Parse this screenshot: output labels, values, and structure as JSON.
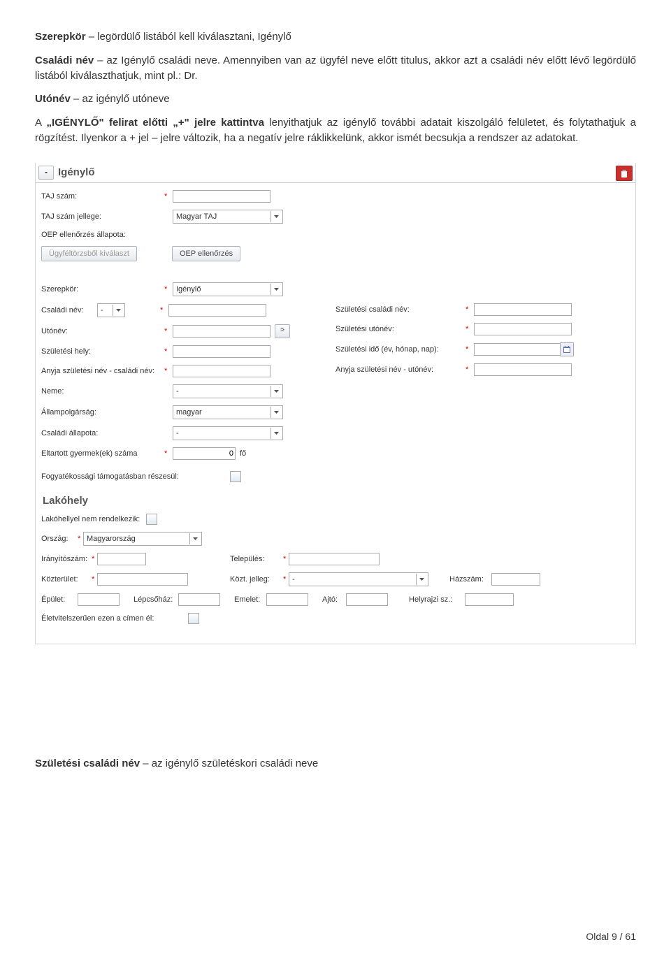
{
  "doc": {
    "p1_a": "Szerepkör",
    "p1_b": " – legördülő listából kell kiválasztani, Igénylő",
    "p2_a": "Családi név",
    "p2_b": " – az Igénylő családi neve. Amennyiben van az ügyfél neve előtt titulus, akkor azt a családi név előtt lévő legördülő listából kiválaszthatjuk, mint pl.: Dr.",
    "p3_a": "Utónév",
    "p3_b": " – az igénylő utóneve",
    "p4_pre": "A ",
    "p4_q": "„IGÉNYLŐ\" felirat előtti „+\" jelre kattintva",
    "p4_post": " lenyithatjuk az igénylő további adatait kiszolgáló felületet, és folytathatjuk a rögzítést. Ilyenkor a + jel – jelre változik, ha a negatív jelre ráklikkelünk, akkor ismét becsukja a rendszer az adatokat.",
    "footer_a": "Születési családi név",
    "footer_b": " – az igénylő születéskori családi neve",
    "page": "Oldal 9 / 61"
  },
  "form": {
    "toggle": "-",
    "section": "Igénylő",
    "taj": "TAJ szám:",
    "taj_jelleg": "TAJ szám jellege:",
    "taj_jelleg_val": "Magyar TAJ",
    "oep_status": "OEP ellenőrzés állapota:",
    "btn_ugyfeltorzs": "Ügyféltörzsből kiválaszt",
    "btn_oep": "OEP ellenőrzés",
    "szerepkor": "Szerepkör:",
    "szerepkor_val": "Igénylő",
    "csaladi": "Családi név:",
    "titulus": "-",
    "szul_csaladi": "Születési családi név:",
    "utonev": "Utónév:",
    "copy_btn": ">",
    "szul_utonev": "Születési utónév:",
    "szul_hely": "Születési hely:",
    "szul_ido": "Születési idő (év, hónap, nap):",
    "anyja_csaladi": "Anyja születési név - családi név:",
    "anyja_utonev": "Anyja születési név - utónév:",
    "neme": "Neme:",
    "neme_val": "-",
    "allampolg": "Állampolgárság:",
    "allampolg_val": "magyar",
    "csaladi_all": "Családi állapota:",
    "csaladi_all_val": "-",
    "gyermek": "Eltartott gyermek(ek) száma",
    "gyermek_val": "0",
    "fo": "fő",
    "fogyatek": "Fogyatékossági támogatásban részesül:",
    "lakohely": "Lakóhely",
    "lakohely_nincs": "Lakóhellyel nem rendelkezik:",
    "orszag": "Ország:",
    "orszag_val": "Magyarország",
    "irsz": "Irányítószám:",
    "telep": "Település:",
    "kozter": "Közterület:",
    "kozt_jelleg": "Közt. jelleg:",
    "kozt_jelleg_val": "-",
    "hazszam": "Házszám:",
    "epulet": "Épület:",
    "lepcsohaz": "Lépcsőház:",
    "emelet": "Emelet:",
    "ajto": "Ajtó:",
    "hrsz": "Helyrajzi sz.:",
    "eletvitel": "Életvitelszerűen ezen a címen él:"
  }
}
